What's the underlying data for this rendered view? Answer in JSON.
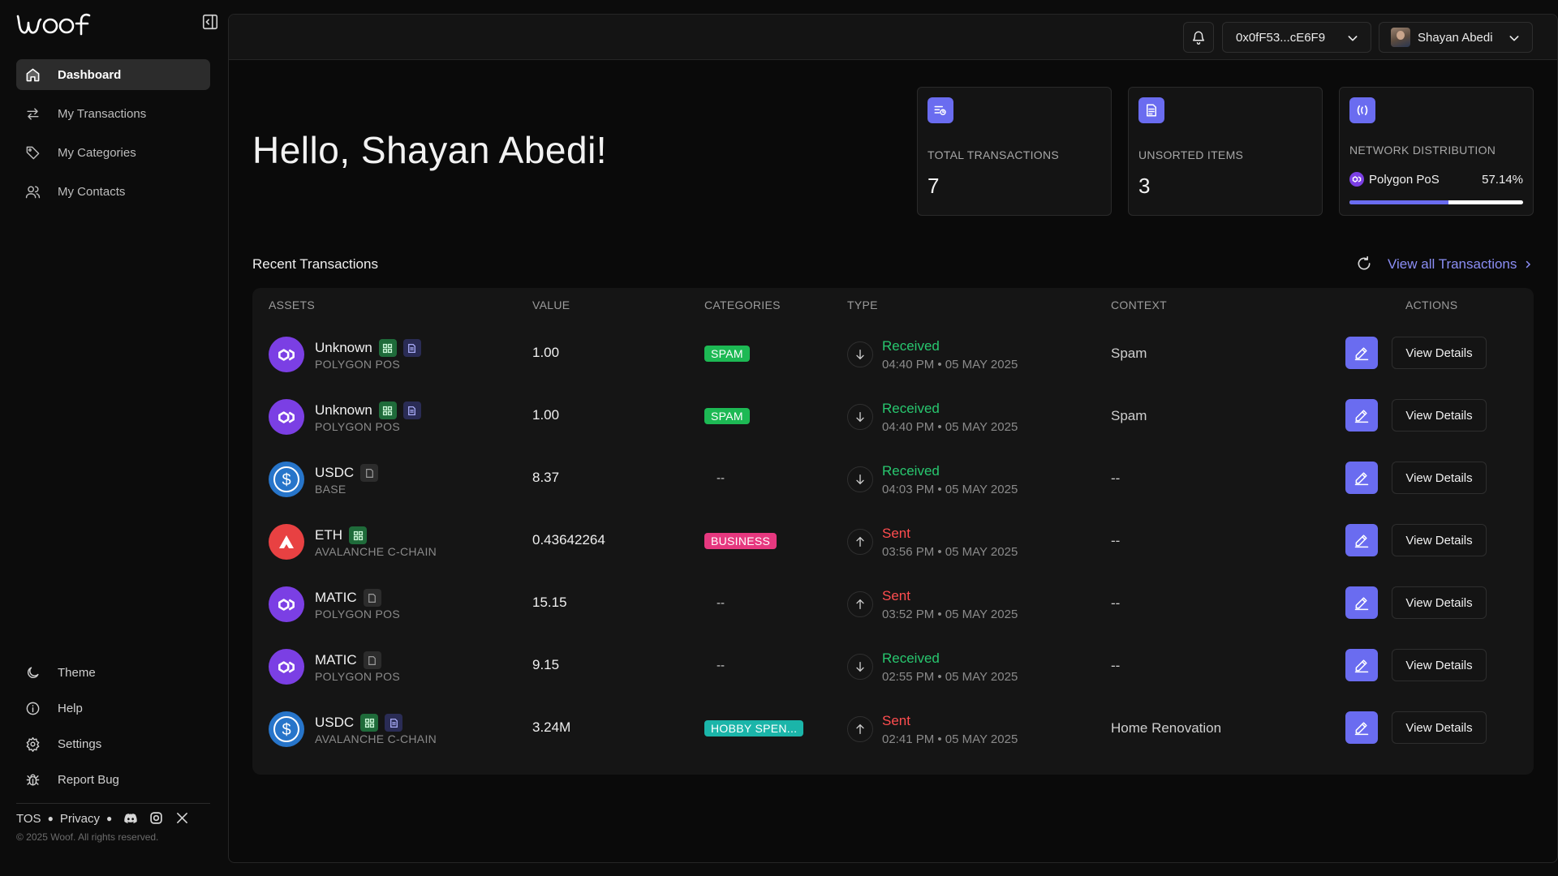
{
  "brand": {
    "logo_text": "woof"
  },
  "sidebar": {
    "items": [
      {
        "label": "Dashboard",
        "icon": "home-icon",
        "active": true
      },
      {
        "label": "My Transactions",
        "icon": "arrows-icon",
        "active": false
      },
      {
        "label": "My Categories",
        "icon": "tag-icon",
        "active": false
      },
      {
        "label": "My Contacts",
        "icon": "users-icon",
        "active": false
      }
    ],
    "bottom_items": [
      {
        "label": "Theme",
        "icon": "moon-icon"
      },
      {
        "label": "Help",
        "icon": "info-icon"
      },
      {
        "label": "Settings",
        "icon": "gear-icon"
      },
      {
        "label": "Report Bug",
        "icon": "bug-icon"
      }
    ],
    "footer": {
      "tos": "TOS",
      "privacy": "Privacy",
      "copyright": "© 2025 Woof. All rights reserved."
    }
  },
  "header": {
    "wallet": "0x0fF53...cE6F9",
    "user_name": "Shayan Abedi"
  },
  "greeting": "Hello, Shayan Abedi!",
  "stats": {
    "total_transactions": {
      "label": "TOTAL TRANSACTIONS",
      "value": "7"
    },
    "unsorted_items": {
      "label": "UNSORTED ITEMS",
      "value": "3"
    },
    "network_distribution": {
      "label": "NETWORK DISTRIBUTION",
      "network": "Polygon PoS",
      "percent": "57.14%",
      "fraction": 0.5714
    }
  },
  "recent": {
    "title": "Recent Transactions",
    "view_all": "View all Transactions",
    "columns": [
      "ASSETS",
      "VALUE",
      "CATEGORIES",
      "TYPE",
      "CONTEXT",
      "ACTIONS"
    ],
    "details_label": "View Details",
    "rows": [
      {
        "asset": "Unknown",
        "network": "POLYGON POS",
        "logo": "polygon",
        "badges": [
          "green",
          "blue"
        ],
        "value": "1.00",
        "category": "SPAM",
        "category_style": "spam",
        "type": "Received",
        "direction": "in",
        "time": "04:40 PM • 05 MAY 2025",
        "context": "Spam"
      },
      {
        "asset": "Unknown",
        "network": "POLYGON POS",
        "logo": "polygon",
        "badges": [
          "green",
          "blue"
        ],
        "value": "1.00",
        "category": "SPAM",
        "category_style": "spam",
        "type": "Received",
        "direction": "in",
        "time": "04:40 PM • 05 MAY 2025",
        "context": "Spam"
      },
      {
        "asset": "USDC",
        "network": "BASE",
        "logo": "usdc",
        "badges": [
          "gray"
        ],
        "value": "8.37",
        "category": "--",
        "category_style": "none",
        "type": "Received",
        "direction": "in",
        "time": "04:03 PM • 05 MAY 2025",
        "context": "--"
      },
      {
        "asset": "ETH",
        "network": "AVALANCHE C-CHAIN",
        "logo": "avax",
        "badges": [
          "green"
        ],
        "value": "0.43642264",
        "category": "BUSINESS",
        "category_style": "business",
        "type": "Sent",
        "direction": "out",
        "time": "03:56 PM • 05 MAY 2025",
        "context": "--"
      },
      {
        "asset": "MATIC",
        "network": "POLYGON POS",
        "logo": "polygon",
        "badges": [
          "gray"
        ],
        "value": "15.15",
        "category": "--",
        "category_style": "none",
        "type": "Sent",
        "direction": "out",
        "time": "03:52 PM • 05 MAY 2025",
        "context": "--"
      },
      {
        "asset": "MATIC",
        "network": "POLYGON POS",
        "logo": "polygon",
        "badges": [
          "gray"
        ],
        "value": "9.15",
        "category": "--",
        "category_style": "none",
        "type": "Received",
        "direction": "in",
        "time": "02:55 PM • 05 MAY 2025",
        "context": "--"
      },
      {
        "asset": "USDC",
        "network": "AVALANCHE C-CHAIN",
        "logo": "usdc",
        "badges": [
          "green",
          "blue"
        ],
        "value": "3.24M",
        "category": "HOBBY SPEN...",
        "category_style": "hobby",
        "type": "Sent",
        "direction": "out",
        "time": "02:41 PM • 05 MAY 2025",
        "context": "Home Renovation"
      }
    ]
  },
  "colors": {
    "accent": "#6a6cf0",
    "received": "#28c76f",
    "sent": "#ff4d4f",
    "polygon": "#7b3fe4",
    "usdc": "#2775ca",
    "avax": "#e84142"
  }
}
